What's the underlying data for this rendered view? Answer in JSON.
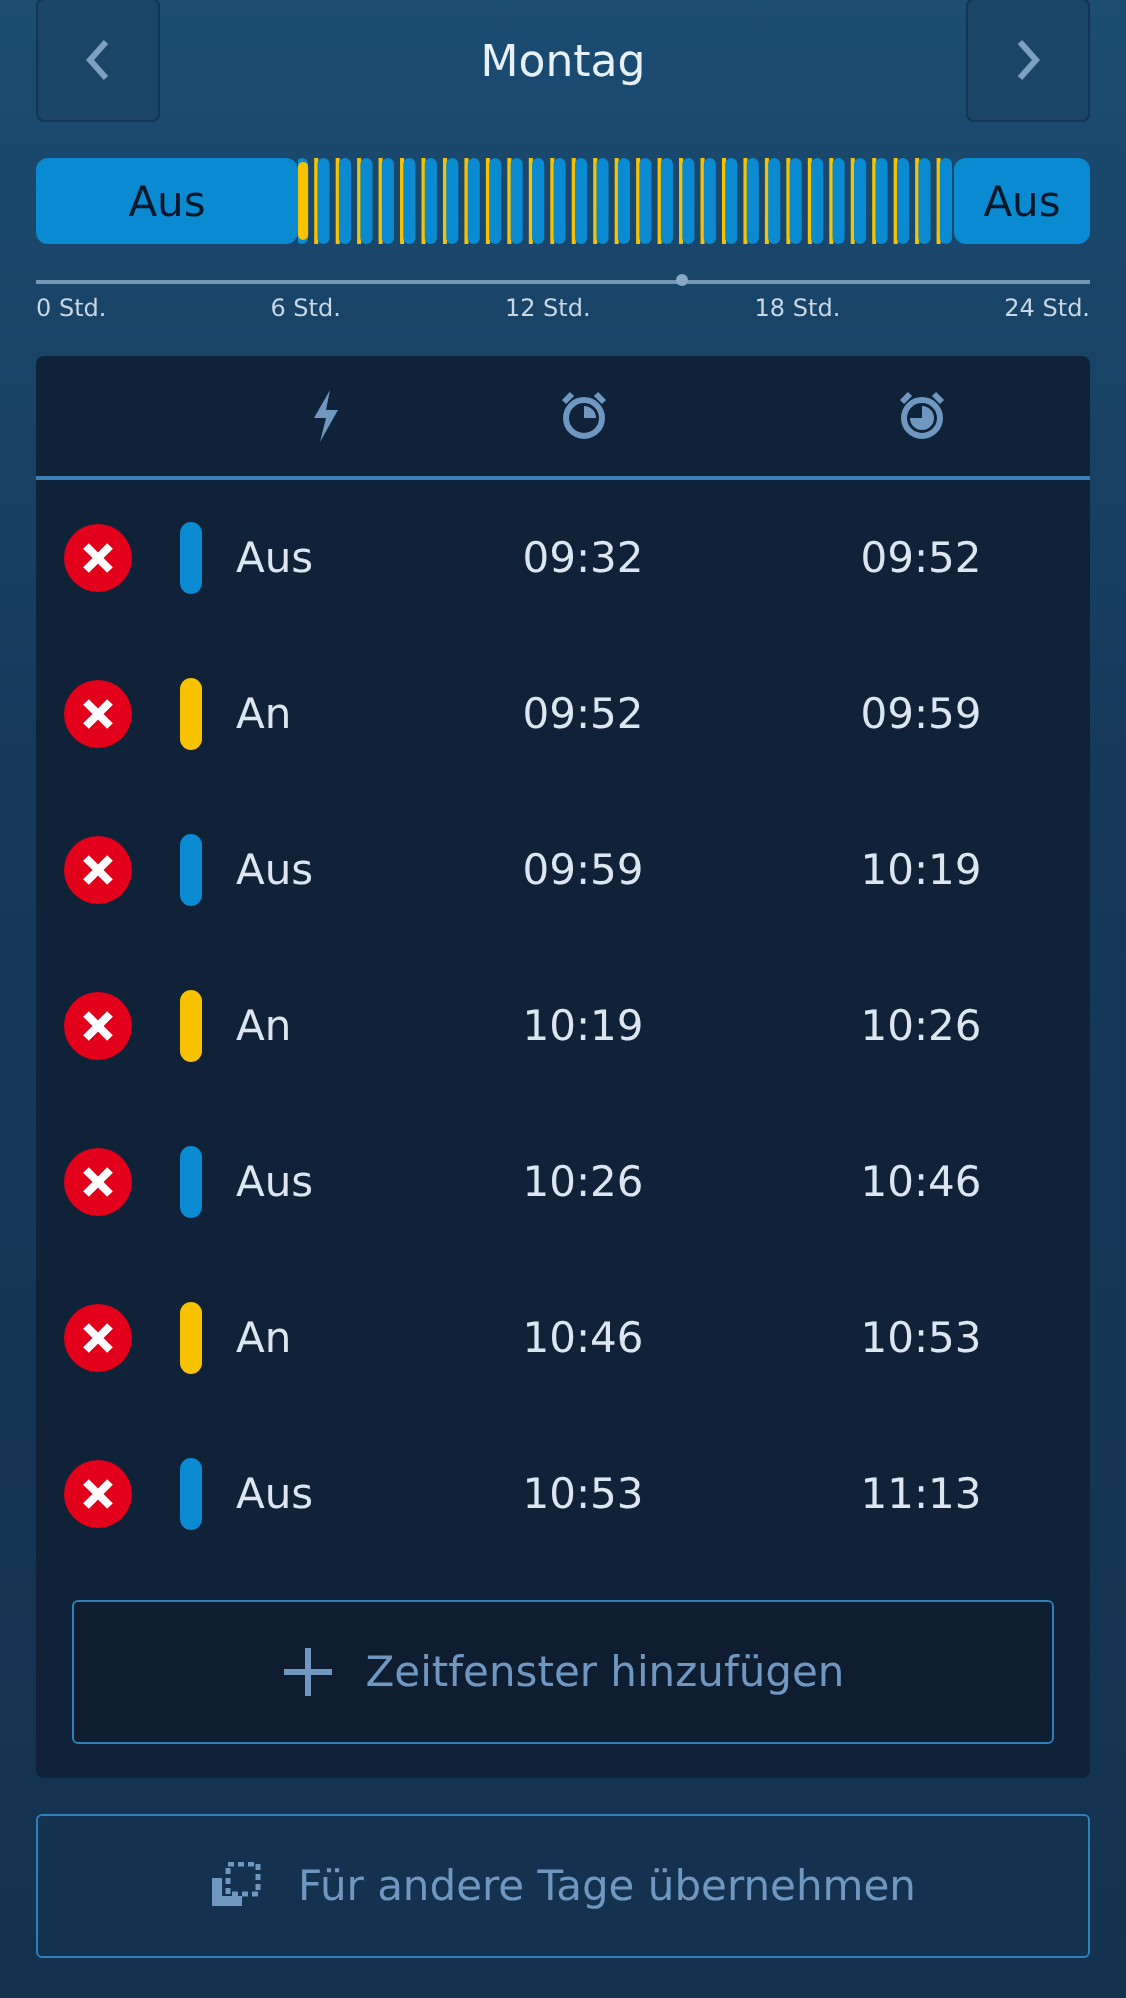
{
  "header": {
    "title": "Montag"
  },
  "timeline": {
    "start_label": "Aus",
    "end_label": "Aus",
    "axis_labels": [
      "0 Std.",
      "6 Std.",
      "12 Std.",
      "18 Std.",
      "24 Std."
    ]
  },
  "rows": [
    {
      "kind": "off",
      "label": "Aus",
      "start": "09:32",
      "end": "09:52"
    },
    {
      "kind": "on",
      "label": "An",
      "start": "09:52",
      "end": "09:59"
    },
    {
      "kind": "off",
      "label": "Aus",
      "start": "09:59",
      "end": "10:19"
    },
    {
      "kind": "on",
      "label": "An",
      "start": "10:19",
      "end": "10:26"
    },
    {
      "kind": "off",
      "label": "Aus",
      "start": "10:26",
      "end": "10:46"
    },
    {
      "kind": "on",
      "label": "An",
      "start": "10:46",
      "end": "10:53"
    },
    {
      "kind": "off",
      "label": "Aus",
      "start": "10:53",
      "end": "11:13"
    }
  ],
  "add_button": "Zeitfenster hinzufügen",
  "copy_button": "Für andere Tage übernehmen"
}
